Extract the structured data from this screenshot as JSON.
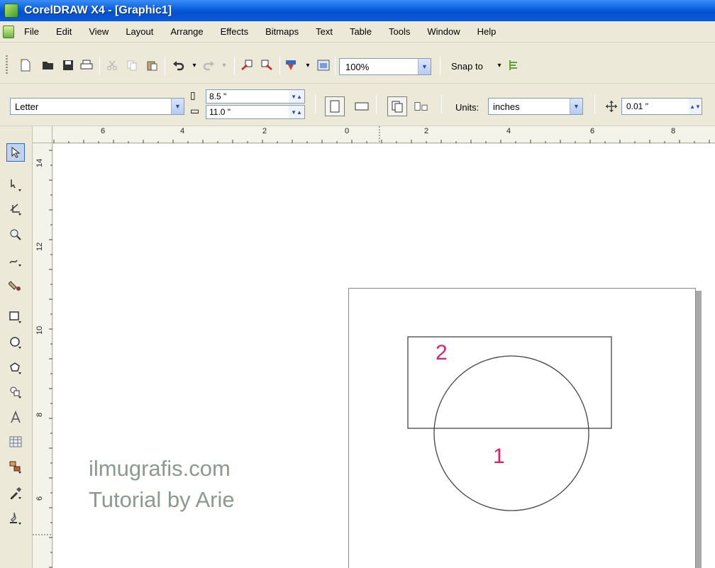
{
  "window": {
    "title": "CorelDRAW X4 - [Graphic1]"
  },
  "menu": [
    "File",
    "Edit",
    "View",
    "Layout",
    "Arrange",
    "Effects",
    "Bitmaps",
    "Text",
    "Table",
    "Tools",
    "Window",
    "Help"
  ],
  "toolbar": {
    "zoom": "100%",
    "snap_label": "Snap to"
  },
  "property_bar": {
    "paper_type": "Letter",
    "width": "8.5 \"",
    "height": "11.0 \"",
    "units_label": "Units:",
    "units": "inches",
    "nudge": "0.01 \""
  },
  "ruler": {
    "horizontal": [
      "6",
      "4",
      "2",
      "0",
      "2",
      "4",
      "6",
      "8"
    ],
    "vertical": [
      "14",
      "12",
      "10",
      "8",
      "6"
    ]
  },
  "canvas": {
    "watermark_line1": "ilmugrafis.com",
    "watermark_line2": "Tutorial by Arie",
    "label_rect": "2",
    "label_circle": "1"
  },
  "colors": {
    "accent": "#0a5ee0",
    "label": "#d6246e",
    "watermark": "#8a9a8f"
  }
}
